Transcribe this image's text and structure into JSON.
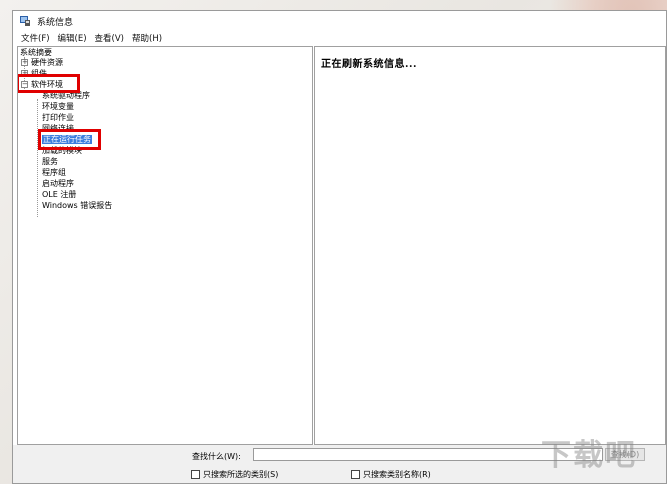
{
  "window": {
    "title": "系统信息"
  },
  "menu": [
    "文件(F)",
    "编辑(E)",
    "查看(V)",
    "帮助(H)"
  ],
  "tree": {
    "root": "系统摘要",
    "hardware": "硬件资源",
    "components": "组件",
    "software": "软件环境",
    "children": [
      "系统驱动程序",
      "环境变量",
      "打印作业",
      "网络连接",
      "正在运行任务",
      "加载的模块",
      "服务",
      "程序组",
      "启动程序",
      "OLE 注册",
      "Windows 错误报告"
    ],
    "selected_index": 4
  },
  "info_pane": {
    "message": "正在刷新系统信息..."
  },
  "find": {
    "label": "查找什么(W):",
    "value": "",
    "button": "查找(D)",
    "checkbox1": "只搜索所选的类别(S)",
    "checkbox2": "只搜索类别名称(R)"
  },
  "watermark": {
    "text": "下载吧"
  },
  "colors": {
    "highlight": "#e00000",
    "selection": "#3b7ddd"
  }
}
